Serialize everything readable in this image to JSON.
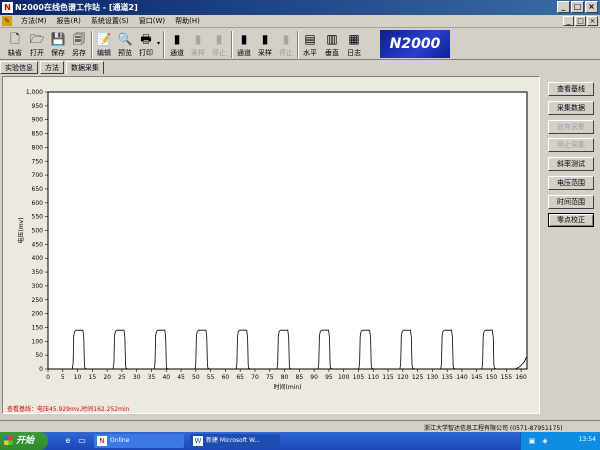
{
  "window": {
    "title": "N2000在线色谱工作站 - [通道2]",
    "controls": [
      "_",
      "□",
      "×"
    ]
  },
  "menu": {
    "items": [
      "方法(M)",
      "报告(R)",
      "系统设置(S)",
      "窗口(W)",
      "帮助(H)"
    ],
    "mdi_controls": [
      "_",
      "□",
      "×"
    ]
  },
  "toolbar": {
    "buttons": [
      {
        "label": "缺省",
        "icon": "new-doc-icon",
        "enabled": true
      },
      {
        "label": "打开",
        "icon": "open-folder-icon",
        "enabled": true
      },
      {
        "label": "保存",
        "icon": "save-disk-icon",
        "enabled": true
      },
      {
        "label": "另存",
        "icon": "save-as-icon",
        "enabled": true
      },
      {
        "label": "编辑",
        "icon": "edit-icon",
        "enabled": true
      },
      {
        "label": "预览",
        "icon": "preview-icon",
        "enabled": true
      },
      {
        "label": "打印",
        "icon": "print-icon",
        "enabled": true
      },
      {
        "label": "通道",
        "icon": "channel1-icon",
        "enabled": true
      },
      {
        "label": "采样",
        "icon": "sample1-icon",
        "enabled": false
      },
      {
        "label": "停止",
        "icon": "stop1-icon",
        "enabled": false
      },
      {
        "label": "通道",
        "icon": "channel2-icon",
        "enabled": true
      },
      {
        "label": "采样",
        "icon": "sample2-icon",
        "enabled": true
      },
      {
        "label": "停止",
        "icon": "stop2-icon",
        "enabled": false
      },
      {
        "label": "水平",
        "icon": "horizontal-icon",
        "enabled": true
      },
      {
        "label": "垂直",
        "icon": "vertical-icon",
        "enabled": true
      },
      {
        "label": "日志",
        "icon": "log-icon",
        "enabled": true
      }
    ],
    "logo_text": "N2000"
  },
  "tabs": [
    {
      "label": "实验信息",
      "active": false
    },
    {
      "label": "方法",
      "active": false
    },
    {
      "label": "数据采集",
      "active": true
    }
  ],
  "side_buttons": [
    {
      "label": "查看基线",
      "enabled": true,
      "focused": false
    },
    {
      "label": "采集数据",
      "enabled": true,
      "focused": false
    },
    {
      "label": "放弃采集",
      "enabled": false,
      "focused": false
    },
    {
      "label": "停止采集",
      "enabled": false,
      "focused": false
    },
    {
      "label": "斜率测试",
      "enabled": true,
      "focused": false
    },
    {
      "label": "电压范围",
      "enabled": true,
      "focused": false
    },
    {
      "label": "时间范围",
      "enabled": true,
      "focused": false
    },
    {
      "label": "零点校正",
      "enabled": true,
      "focused": true
    }
  ],
  "status_line": "查看基线：电压45.929mv,时间162.252min",
  "statusbar": {
    "company": "浙江大学智达信息工程有限公司  (0571-87951175)"
  },
  "taskbar": {
    "start_label": "开始",
    "tasks": [
      {
        "label": "Online"
      },
      {
        "label": "新建 Microsoft W..."
      }
    ],
    "clock": "13:54"
  },
  "chart_data": {
    "type": "line",
    "ylabel": "电压(mv)",
    "xlabel": "时间(min)",
    "ylim": [
      0,
      1000
    ],
    "xlim": [
      0,
      162
    ],
    "y_ticks": [
      0,
      50,
      100,
      150,
      200,
      250,
      300,
      350,
      400,
      450,
      500,
      550,
      600,
      650,
      700,
      750,
      800,
      850,
      900,
      950,
      1000
    ],
    "y_tick_labels": [
      "0",
      "50",
      "100",
      "150",
      "200",
      "250",
      "300",
      "350",
      "400",
      "450",
      "500",
      "550",
      "600",
      "650",
      "700",
      "750",
      "800",
      "850",
      "900",
      "950",
      "1,000"
    ],
    "x_ticks": [
      0,
      5,
      10,
      15,
      20,
      25,
      30,
      35,
      40,
      45,
      50,
      55,
      60,
      65,
      70,
      75,
      80,
      85,
      90,
      95,
      100,
      105,
      110,
      115,
      120,
      125,
      130,
      135,
      140,
      145,
      150,
      155,
      160
    ],
    "grid": false,
    "series": [
      {
        "color": "#000000",
        "pulses": [
          {
            "rise": 8.5,
            "fall": 12.3
          },
          {
            "rise": 22.3,
            "fall": 26.2
          },
          {
            "rise": 36.2,
            "fall": 40.0
          },
          {
            "rise": 50.0,
            "fall": 53.9
          },
          {
            "rise": 63.9,
            "fall": 67.7
          },
          {
            "rise": 77.7,
            "fall": 81.6
          },
          {
            "rise": 91.6,
            "fall": 95.4
          },
          {
            "rise": 105.4,
            "fall": 109.3
          },
          {
            "rise": 119.3,
            "fall": 123.1
          },
          {
            "rise": 133.1,
            "fall": 137.0
          },
          {
            "rise": 147.0,
            "fall": 150.8
          }
        ],
        "baseline": 0,
        "peak": 140,
        "end_value": 46
      }
    ]
  }
}
